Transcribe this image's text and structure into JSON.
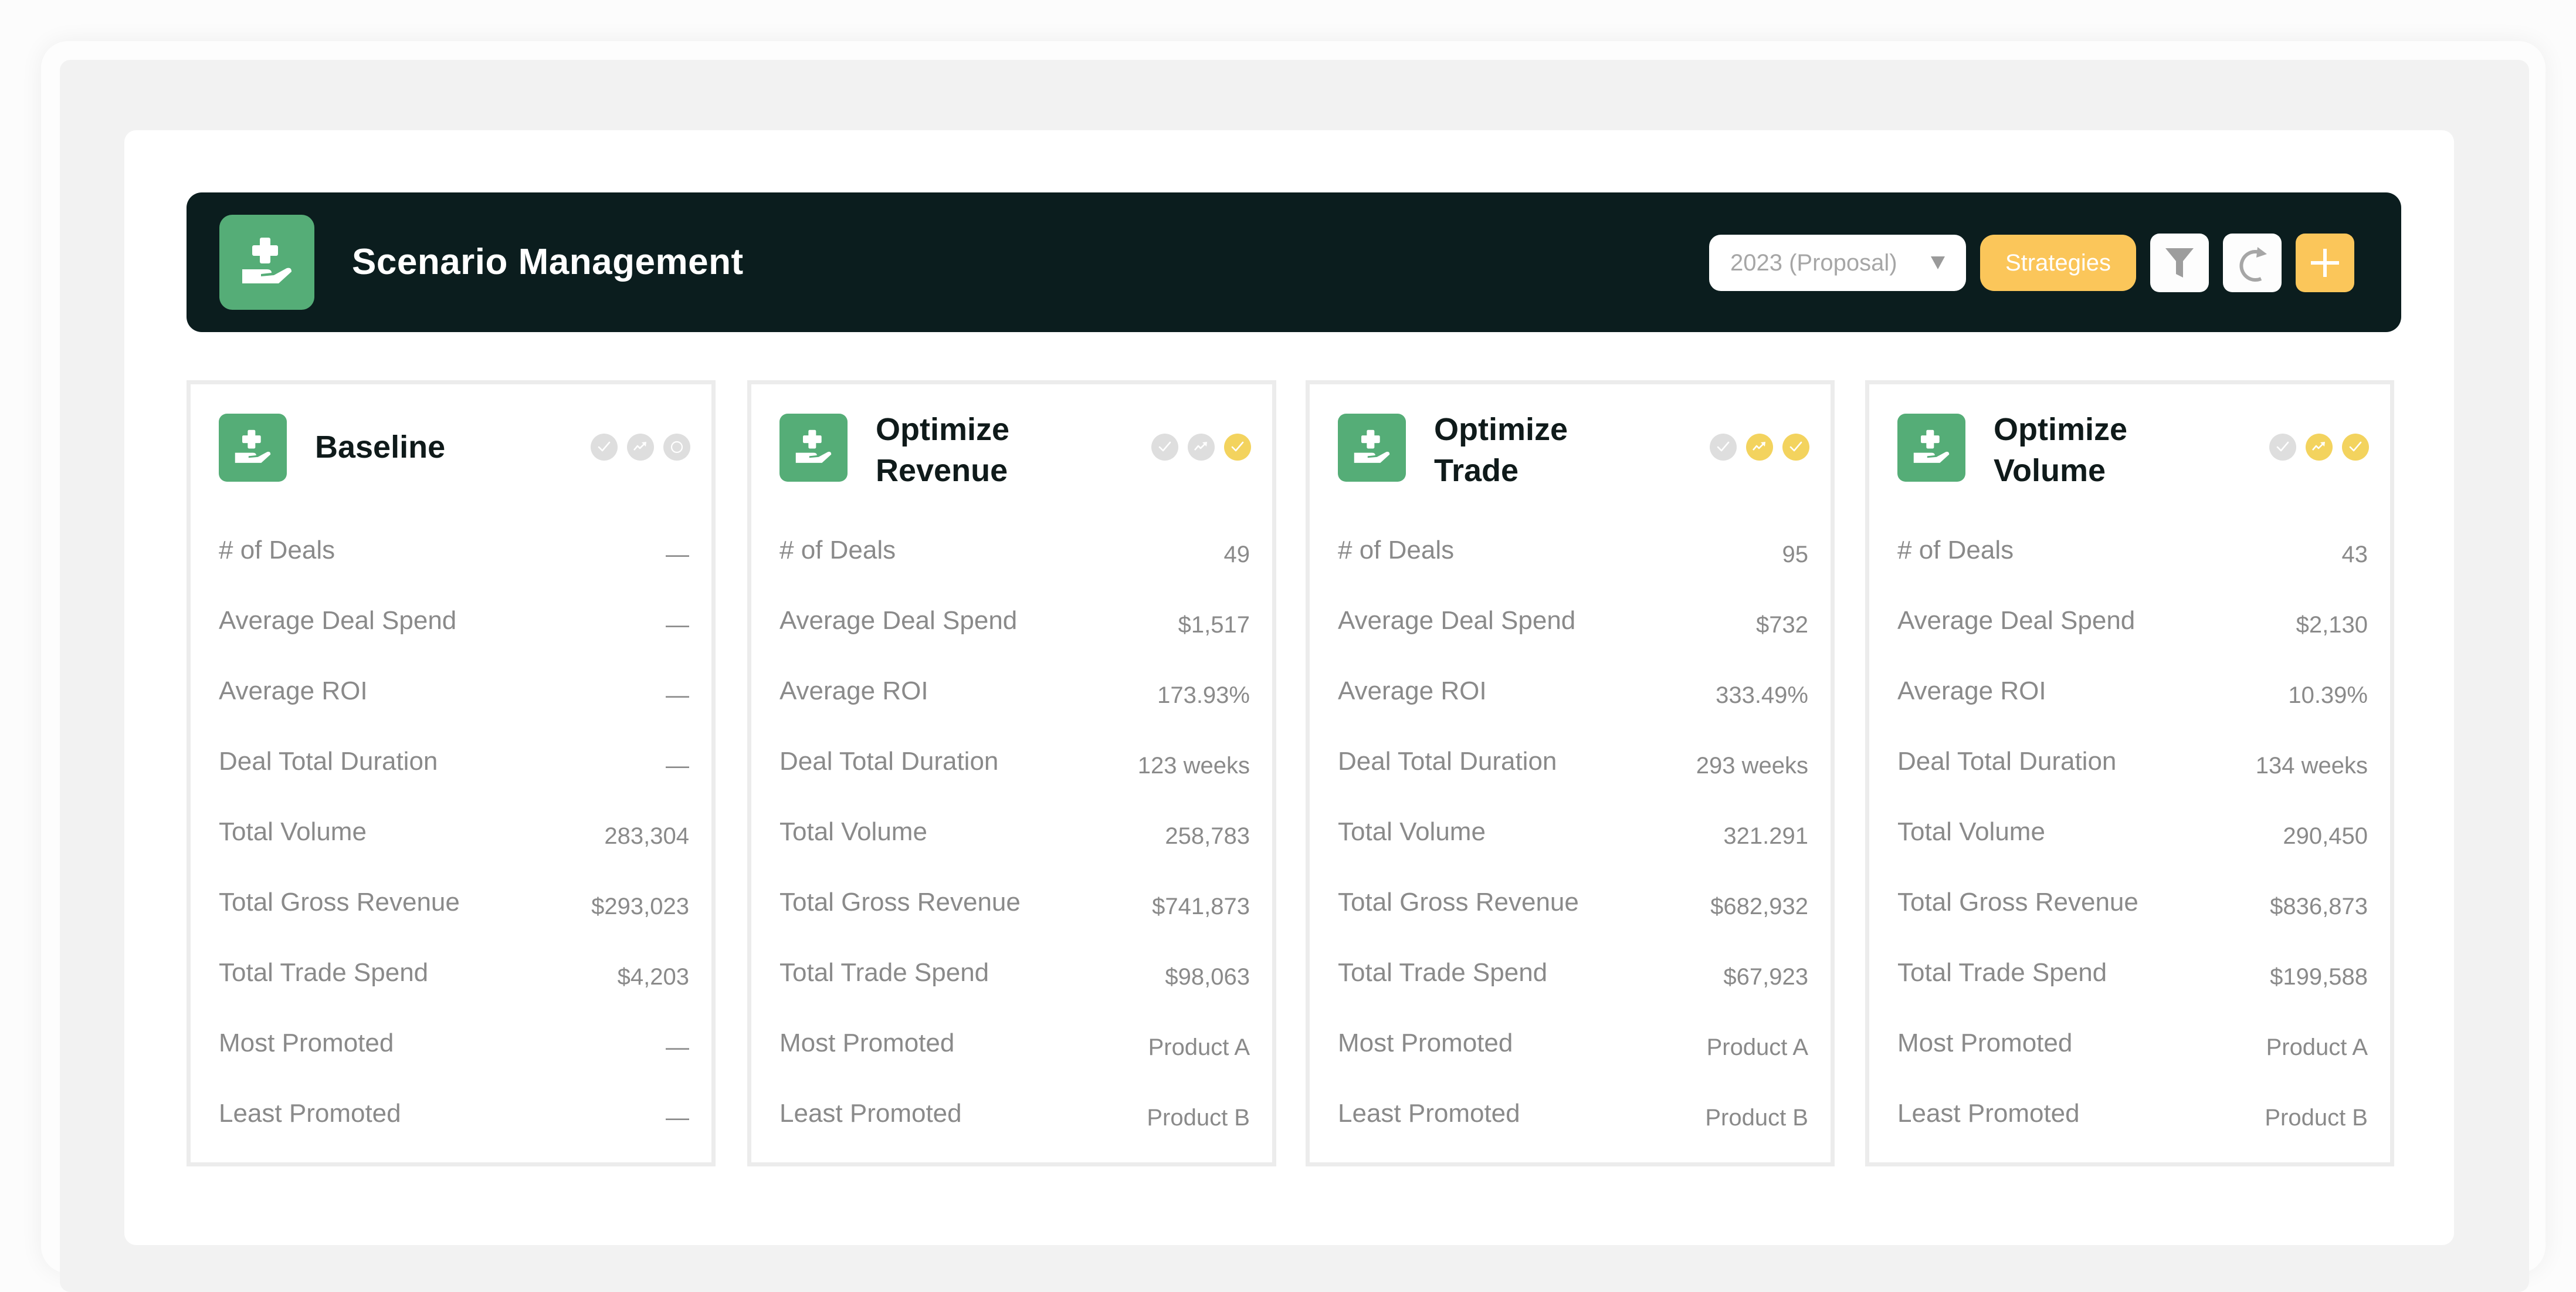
{
  "header": {
    "title": "Scenario Management",
    "logo_icon": "hand-holding-medical-icon",
    "year_select": {
      "value": "2023 (Proposal)",
      "icon": "caret-down-icon"
    },
    "strategies_label": "Strategies",
    "filter_icon": "filter-icon",
    "refresh_icon": "refresh-icon",
    "add_icon": "plus-icon"
  },
  "colors": {
    "header_bg": "#0b1d1e",
    "brand_green": "#55ad77",
    "accent_yellow": "#fbc65a",
    "status_active": "#f3d35e",
    "status_inactive": "#dedede",
    "text_muted": "#8a8a8a"
  },
  "metric_labels": [
    "# of Deals",
    "Average Deal Spend",
    "Average ROI",
    "Deal Total Duration",
    "Total Volume",
    "Total Gross Revenue",
    "Total Trade Spend",
    "Most Promoted",
    "Least Promoted"
  ],
  "scenarios": [
    {
      "title": "Baseline",
      "status_icons": [
        {
          "icon": "check-icon",
          "active": false
        },
        {
          "icon": "trending-up-icon",
          "active": false
        },
        {
          "icon": "circle-icon",
          "active": false
        }
      ],
      "values": [
        "—",
        "—",
        "—",
        "—",
        "283,304",
        "$293,023",
        "$4,203",
        "—",
        "—"
      ]
    },
    {
      "title": "Optimize Revenue",
      "status_icons": [
        {
          "icon": "check-icon",
          "active": false
        },
        {
          "icon": "trending-up-icon",
          "active": false
        },
        {
          "icon": "check-icon",
          "active": true
        }
      ],
      "values": [
        "49",
        "$1,517",
        "173.93%",
        "123 weeks",
        "258,783",
        "$741,873",
        "$98,063",
        "Product A",
        "Product B"
      ]
    },
    {
      "title": "Optimize Trade",
      "status_icons": [
        {
          "icon": "check-icon",
          "active": false
        },
        {
          "icon": "trending-up-icon",
          "active": true
        },
        {
          "icon": "check-icon",
          "active": true
        }
      ],
      "values": [
        "95",
        "$732",
        "333.49%",
        "293 weeks",
        "321.291",
        "$682,932",
        "$67,923",
        "Product A",
        "Product B"
      ]
    },
    {
      "title": "Optimize Volume",
      "status_icons": [
        {
          "icon": "check-icon",
          "active": false
        },
        {
          "icon": "trending-up-icon",
          "active": true
        },
        {
          "icon": "check-icon",
          "active": true
        }
      ],
      "values": [
        "43",
        "$2,130",
        "10.39%",
        "134 weeks",
        "290,450",
        "$836,873",
        "$199,588",
        "Product A",
        "Product B"
      ]
    }
  ]
}
